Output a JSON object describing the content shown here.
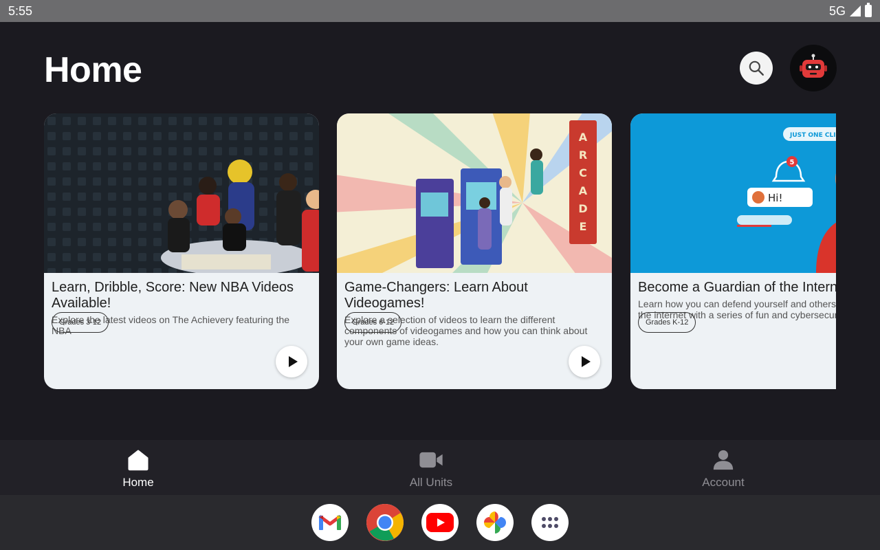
{
  "status_bar": {
    "time": "5:55",
    "network": "5G",
    "icons": [
      "signal-icon",
      "battery-icon"
    ]
  },
  "header": {
    "title": "Home",
    "search_icon": "search-icon",
    "avatar_icon": "robot-avatar-icon"
  },
  "cards": [
    {
      "title": "Learn, Dribble, Score: New NBA Videos Available!",
      "description": "Explore the latest videos on The Achievery featuring the NBA",
      "grade": "Grades 3-12",
      "has_play": true
    },
    {
      "title": "Game-Changers: Learn About Videogames!",
      "description": "Explore a selection of videos to learn the different components of videogames and how you can think about your own game ideas.",
      "grade": "Grades 6-12",
      "has_play": true
    },
    {
      "title": "Become a Guardian of the Interne",
      "description": "Learn how you can defend yourself and others dangers of the internet with a series of fun and cybersecurity videos.",
      "grade": "Grades K-12",
      "has_play": false,
      "image_text": {
        "banner": "JUST ONE CLICK",
        "badge": "5",
        "bubble": "Hi!"
      }
    }
  ],
  "bottom_nav": [
    {
      "label": "Home",
      "icon": "home-icon",
      "active": true
    },
    {
      "label": "All Units",
      "icon": "video-camera-icon",
      "active": false
    },
    {
      "label": "Account",
      "icon": "person-icon",
      "active": false
    }
  ],
  "dock": [
    {
      "icon": "gmail-icon"
    },
    {
      "icon": "chrome-icon"
    },
    {
      "icon": "youtube-icon"
    },
    {
      "icon": "photos-icon"
    },
    {
      "icon": "app-drawer-icon"
    }
  ],
  "colors": {
    "background": "#1b1a20",
    "card_body": "#eef2f5",
    "nav_bg": "#222127",
    "accent_red": "#e83a3a"
  }
}
